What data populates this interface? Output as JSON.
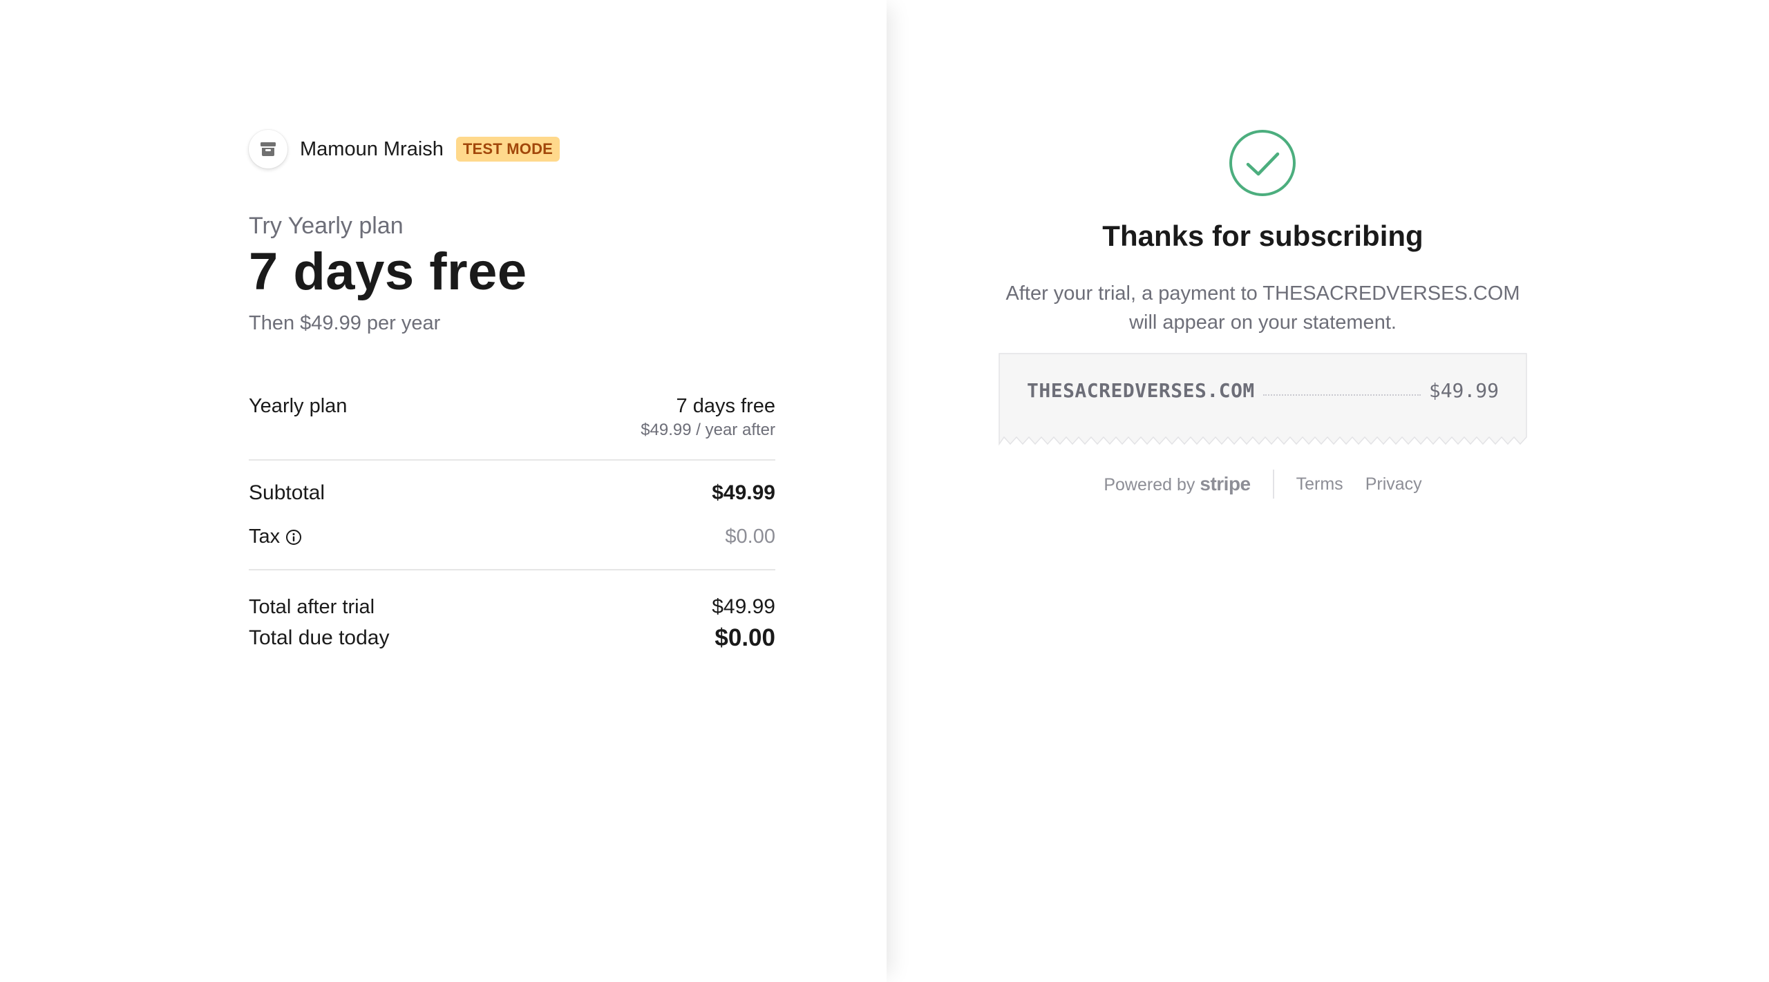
{
  "merchant": {
    "name": "Mamoun Mraish",
    "badge": "TEST MODE",
    "avatar_icon": "store-icon"
  },
  "product": {
    "try_label": "Try Yearly plan",
    "headline": "7 days free",
    "then_price": "Then $49.99 per year"
  },
  "line_items": [
    {
      "name": "Yearly plan",
      "price": "7 days free",
      "sub_price": "$49.99 / year after"
    }
  ],
  "totals": {
    "subtotal_label": "Subtotal",
    "subtotal_value": "$49.99",
    "tax_label": "Tax",
    "tax_value": "$0.00",
    "tax_info_icon": "info-icon",
    "after_trial_label": "Total after trial",
    "after_trial_value": "$49.99",
    "due_today_label": "Total due today",
    "due_today_value": "$0.00"
  },
  "confirmation": {
    "status_icon": "check-circle-icon",
    "title": "Thanks for subscribing",
    "message": "After your trial, a payment to THESACREDVERSES.COM will appear on your statement.",
    "receipt": {
      "descriptor": "THESACREDVERSES.COM",
      "amount": "$49.99"
    }
  },
  "footer": {
    "powered_by": "Powered by",
    "brand": "stripe",
    "links": [
      "Terms",
      "Privacy"
    ]
  },
  "colors": {
    "success_green": "#4cae7e",
    "badge_bg": "#ffd98c",
    "badge_text": "#a2470a",
    "muted_text": "#6d6e78"
  }
}
